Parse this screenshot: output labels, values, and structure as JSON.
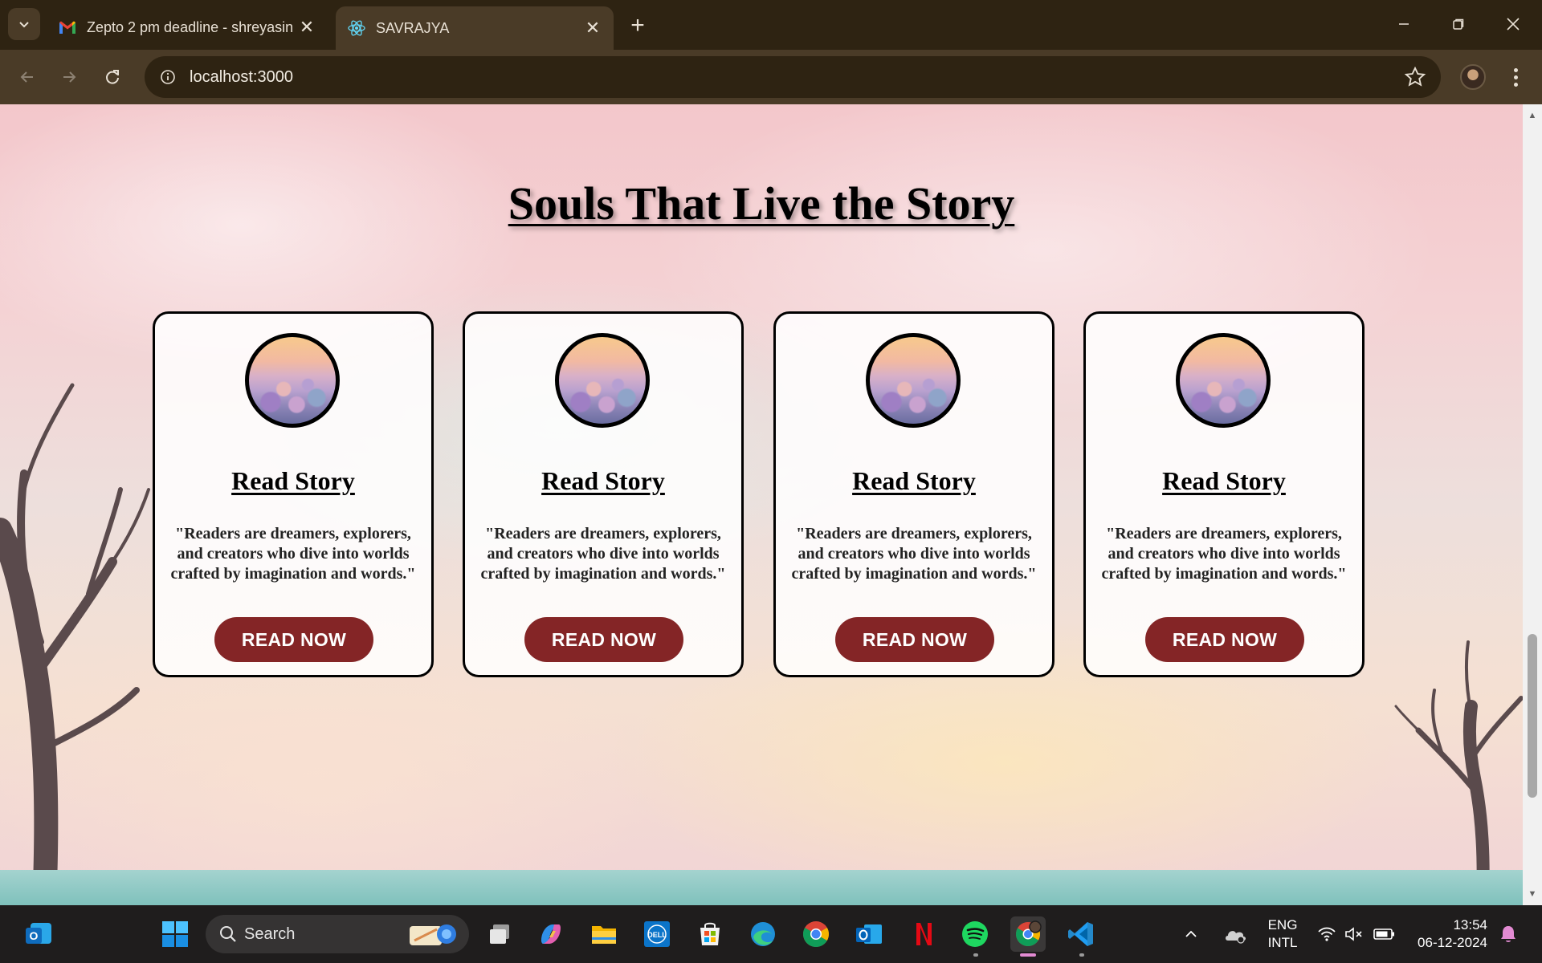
{
  "browser": {
    "tabs": [
      {
        "title": "Zepto 2 pm deadline - shreyasin",
        "favicon": "gmail-icon",
        "active": false
      },
      {
        "title": "SAVRAJYA",
        "favicon": "react-icon",
        "active": true
      }
    ],
    "url": "localhost:3000"
  },
  "page": {
    "heading": "Souls That Live the Story",
    "cards": [
      {
        "title": "Read Story",
        "quote": "\"Readers are dreamers, explorers, and creators who dive into worlds crafted by imagination and words.\"",
        "button": "READ NOW"
      },
      {
        "title": "Read Story",
        "quote": "\"Readers are dreamers, explorers, and creators who dive into worlds crafted by imagination and words.\"",
        "button": "READ NOW"
      },
      {
        "title": "Read Story",
        "quote": "\"Readers are dreamers, explorers, and creators who dive into worlds crafted by imagination and words.\"",
        "button": "READ NOW"
      },
      {
        "title": "Read Story",
        "quote": "\"Readers are dreamers, explorers, and creators who dive into worlds crafted by imagination and words.\"",
        "button": "READ NOW"
      }
    ],
    "colors": {
      "button": "#842526",
      "card_border": "#000000"
    }
  },
  "taskbar": {
    "search_label": "Search",
    "apps": [
      "windows-start-icon",
      "search-icon",
      "task-view-icon",
      "copilot-icon",
      "file-explorer-icon",
      "dell-icon",
      "microsoft-store-icon",
      "edge-icon",
      "chrome-icon",
      "outlook-icon",
      "netflix-icon",
      "spotify-icon",
      "chrome-profile-icon",
      "vscode-icon"
    ],
    "language": {
      "line1": "ENG",
      "line2": "INTL"
    },
    "time": "13:54",
    "date": "06-12-2024"
  }
}
